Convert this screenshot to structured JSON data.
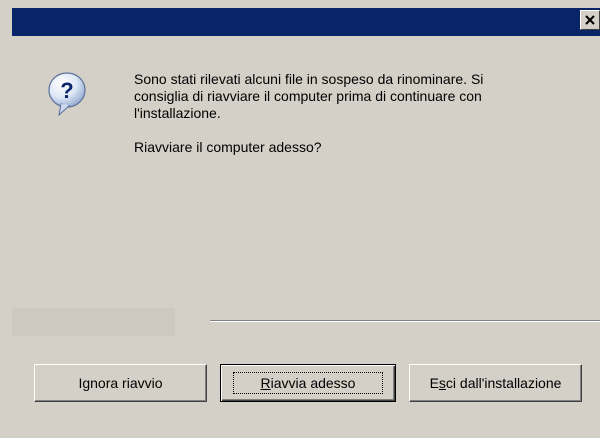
{
  "dialog": {
    "title": "",
    "close_symbol": "×"
  },
  "icon": {
    "name": "question-icon",
    "glyph": "?"
  },
  "message": {
    "line1": "Sono stati rilevati alcuni file in sospeso da rinominare. Si",
    "line2": "consiglia di riavviare il computer prima di continuare con",
    "line3": "l'installazione.",
    "question": "Riavviare il computer adesso?"
  },
  "buttons": {
    "ignore": "Ignora riavvio",
    "restart_mnemonic": "R",
    "restart_rest": "iavvia adesso",
    "exit_prefix": "E",
    "exit_mnemonic": "s",
    "exit_rest": "ci dall'installazione"
  },
  "colors": {
    "titlebar": "#0a246a",
    "window_bg": "#d4d0c8"
  }
}
